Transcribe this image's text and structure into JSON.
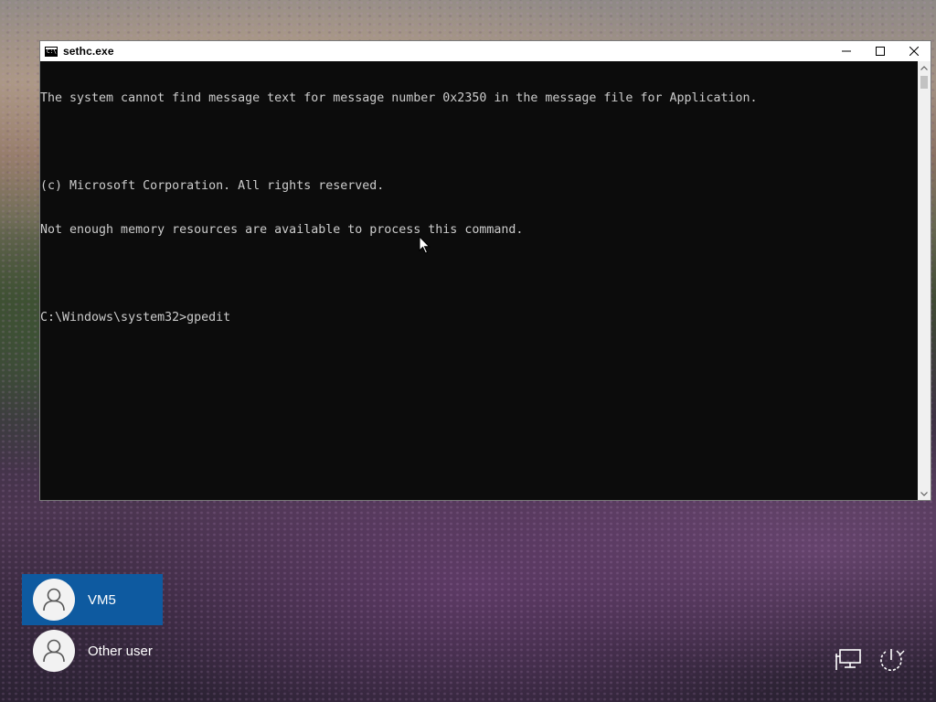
{
  "window": {
    "title": "sethc.exe",
    "controls": {
      "minimize": "minimize-icon",
      "maximize": "maximize-icon",
      "close": "close-icon"
    }
  },
  "console": {
    "lines": [
      "The system cannot find message text for message number 0x2350 in the message file for Application.",
      "",
      "(c) Microsoft Corporation. All rights reserved.",
      "Not enough memory resources are available to process this command.",
      "",
      "C:\\Windows\\system32>gpedit"
    ],
    "background": "#0c0c0c",
    "foreground": "#cccccc"
  },
  "login": {
    "users": [
      {
        "name": "VM5",
        "selected": true
      },
      {
        "name": "Other user",
        "selected": false
      }
    ],
    "accent": "#0e5aa0"
  },
  "tray": {
    "network_icon": "network-icon",
    "power_icon": "power-icon"
  }
}
